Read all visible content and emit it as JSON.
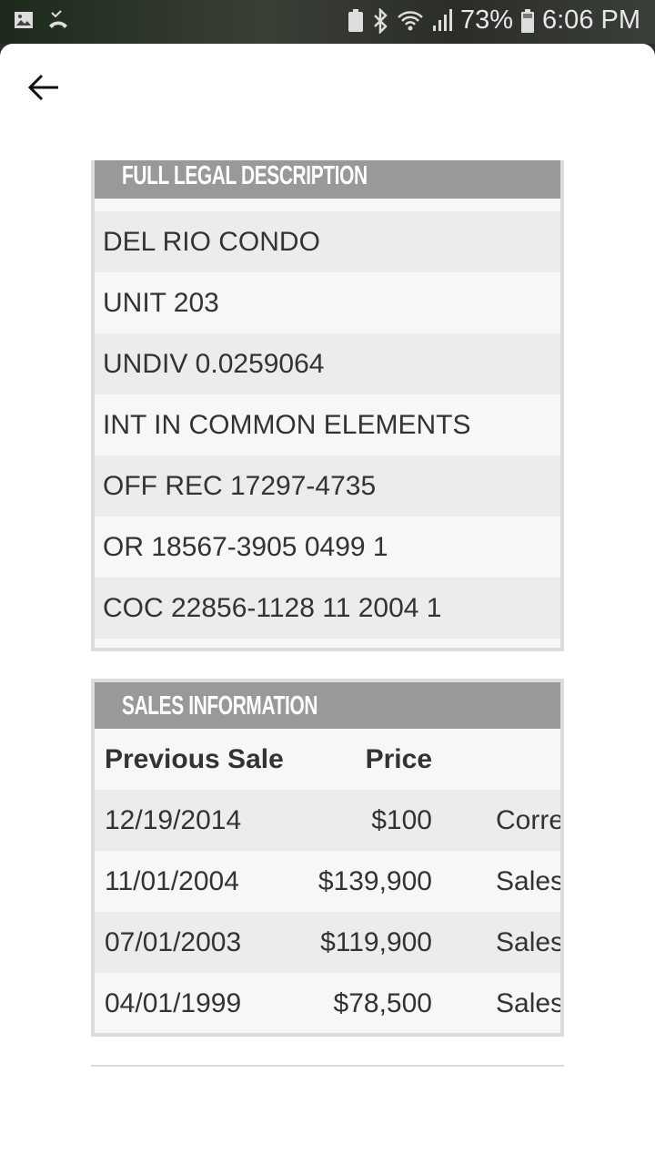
{
  "status_bar": {
    "battery_percent": "73%",
    "time": "6:06 PM",
    "icons": [
      "gallery-icon",
      "missed-call-icon",
      "battery-saver-icon",
      "bluetooth-icon",
      "wifi-icon",
      "signal-icon",
      "battery-icon"
    ]
  },
  "nav": {
    "back_icon": "arrow-left-icon"
  },
  "legal": {
    "title": "FULL LEGAL DESCRIPTION",
    "lines": [
      "DEL RIO CONDO",
      "UNIT 203",
      "UNDIV 0.0259064",
      "INT IN COMMON ELEMENTS",
      "OFF REC 17297-4735",
      "OR 18567-3905 0499 1",
      "COC 22856-1128 11 2004 1"
    ]
  },
  "sales": {
    "title": "SALES INFORMATION",
    "columns": [
      "Previous Sale",
      "Price",
      ""
    ],
    "rows": [
      {
        "date": "12/19/2014",
        "price": "$100",
        "type": "Corre"
      },
      {
        "date": "11/01/2004",
        "price": "$139,900",
        "type": "Sales"
      },
      {
        "date": "07/01/2003",
        "price": "$119,900",
        "type": "Sales"
      },
      {
        "date": "04/01/1999",
        "price": "$78,500",
        "type": "Sales"
      }
    ]
  },
  "colors": {
    "header_bg": "#999999",
    "row_alt": "#ececec",
    "row": "#f7f7f7",
    "border": "#dcdcdc"
  }
}
